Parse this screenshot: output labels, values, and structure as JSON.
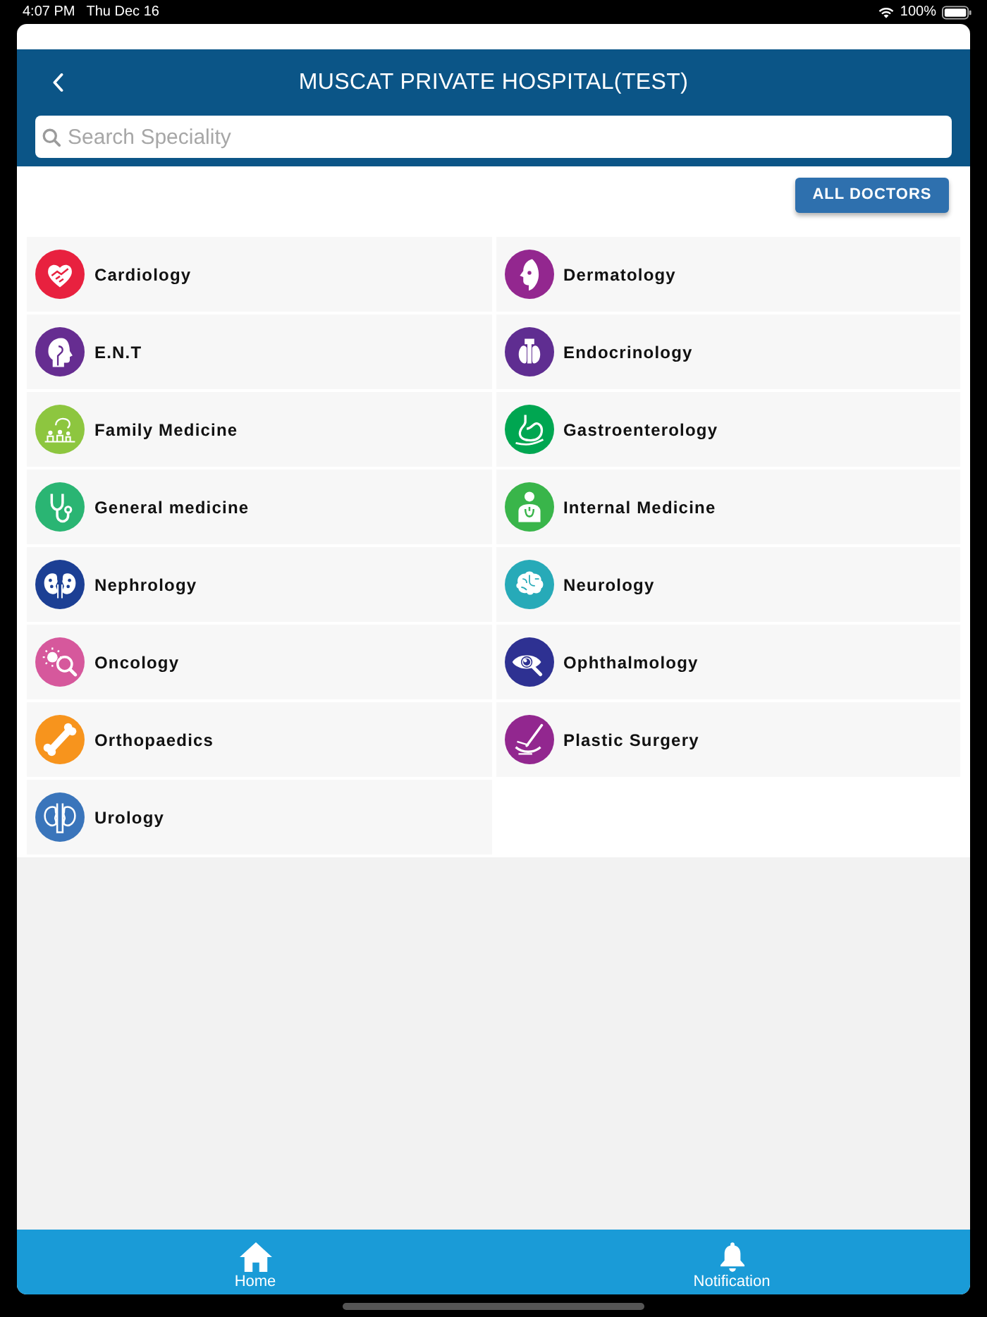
{
  "status_bar": {
    "time": "4:07 PM",
    "date": "Thu Dec 16",
    "battery": "100%"
  },
  "header": {
    "title": "MUSCAT PRIVATE HOSPITAL(TEST)",
    "search": {
      "placeholder": "Search Speciality"
    }
  },
  "all_doctors_button": "ALL DOCTORS",
  "specialities": [
    {
      "name": "Cardiology",
      "color": "#e8213f"
    },
    {
      "name": "Dermatology",
      "color": "#93278f"
    },
    {
      "name": "E.N.T",
      "color": "#662d91"
    },
    {
      "name": "Endocrinology",
      "color": "#5f2d91"
    },
    {
      "name": "Family Medicine",
      "color": "#8dc63f"
    },
    {
      "name": "Gastroenterology",
      "color": "#00a651"
    },
    {
      "name": "General medicine",
      "color": "#2ab573"
    },
    {
      "name": "Internal Medicine",
      "color": "#39b54a"
    },
    {
      "name": "Nephrology",
      "color": "#1c3f94"
    },
    {
      "name": "Neurology",
      "color": "#27aab8"
    },
    {
      "name": "Oncology",
      "color": "#d6589c"
    },
    {
      "name": "Ophthalmology",
      "color": "#2e3192"
    },
    {
      "name": "Orthopaedics",
      "color": "#f7941d"
    },
    {
      "name": "Plastic Surgery",
      "color": "#92278f"
    },
    {
      "name": "Urology",
      "color": "#3a75bb"
    }
  ],
  "tab_bar": [
    {
      "label": "Home"
    },
    {
      "label": "Notification"
    }
  ]
}
